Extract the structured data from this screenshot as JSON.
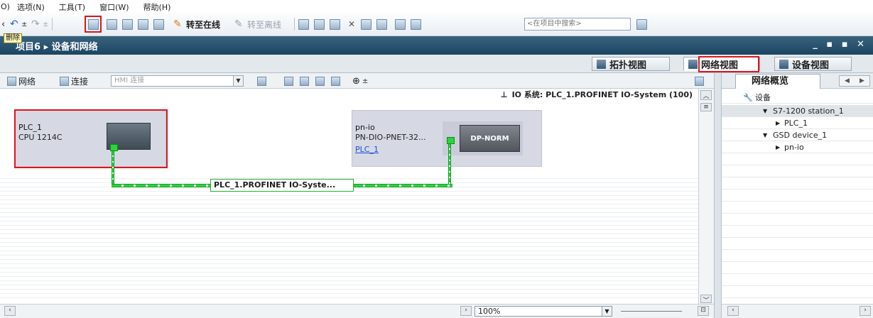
{
  "menu": {
    "items": [
      "O)",
      "选项(N)",
      "工具(T)",
      "窗口(W)",
      "帮助(H)"
    ]
  },
  "toolbar": {
    "go_online": "转至在线",
    "go_offline": "转至离线",
    "search_placeholder": "<在项目中搜索>",
    "tooltip": "删除"
  },
  "title": {
    "text": "项目6 ▸ 设备和网络",
    "prefix": "项目",
    "rest": "6 ▸ 设备和网络"
  },
  "view_tabs": [
    "拓扑视图",
    "网络视图",
    "设备视图"
  ],
  "editor_toolbar": {
    "network": "网络",
    "connections": "连接",
    "hmi_connection": "HMI 连接",
    "zoom_plus": "±"
  },
  "io_system_header": "IO 系统: PLC_1.PROFINET IO-System (100)",
  "devices": {
    "plc": {
      "name": "PLC_1",
      "type": "CPU 1214C"
    },
    "io": {
      "name": "pn-io",
      "type": "PN-DIO-PNET-32...",
      "link": "PLC_1",
      "module": "DP-NORM"
    }
  },
  "network_label": "PLC_1.PROFINET IO-Syste...",
  "zoom": "100%",
  "overview": {
    "tab_label": "网络概览",
    "rows": [
      {
        "arrow": "",
        "label": "设备",
        "indent": 0,
        "selected": false
      },
      {
        "arrow": "▼",
        "label": "S7-1200 station_1",
        "indent": 1,
        "selected": true
      },
      {
        "arrow": "▶",
        "label": "PLC_1",
        "indent": 2,
        "selected": false
      },
      {
        "arrow": "▼",
        "label": "GSD device_1",
        "indent": 1,
        "selected": false
      },
      {
        "arrow": "▶",
        "label": "pn-io",
        "indent": 2,
        "selected": false
      }
    ]
  },
  "window_controls": "_ ▪ ▪ ✕",
  "colors": {
    "highlight_red": "#e0141c",
    "network_green": "#2bd33c",
    "title_bar": "#1b4461"
  }
}
